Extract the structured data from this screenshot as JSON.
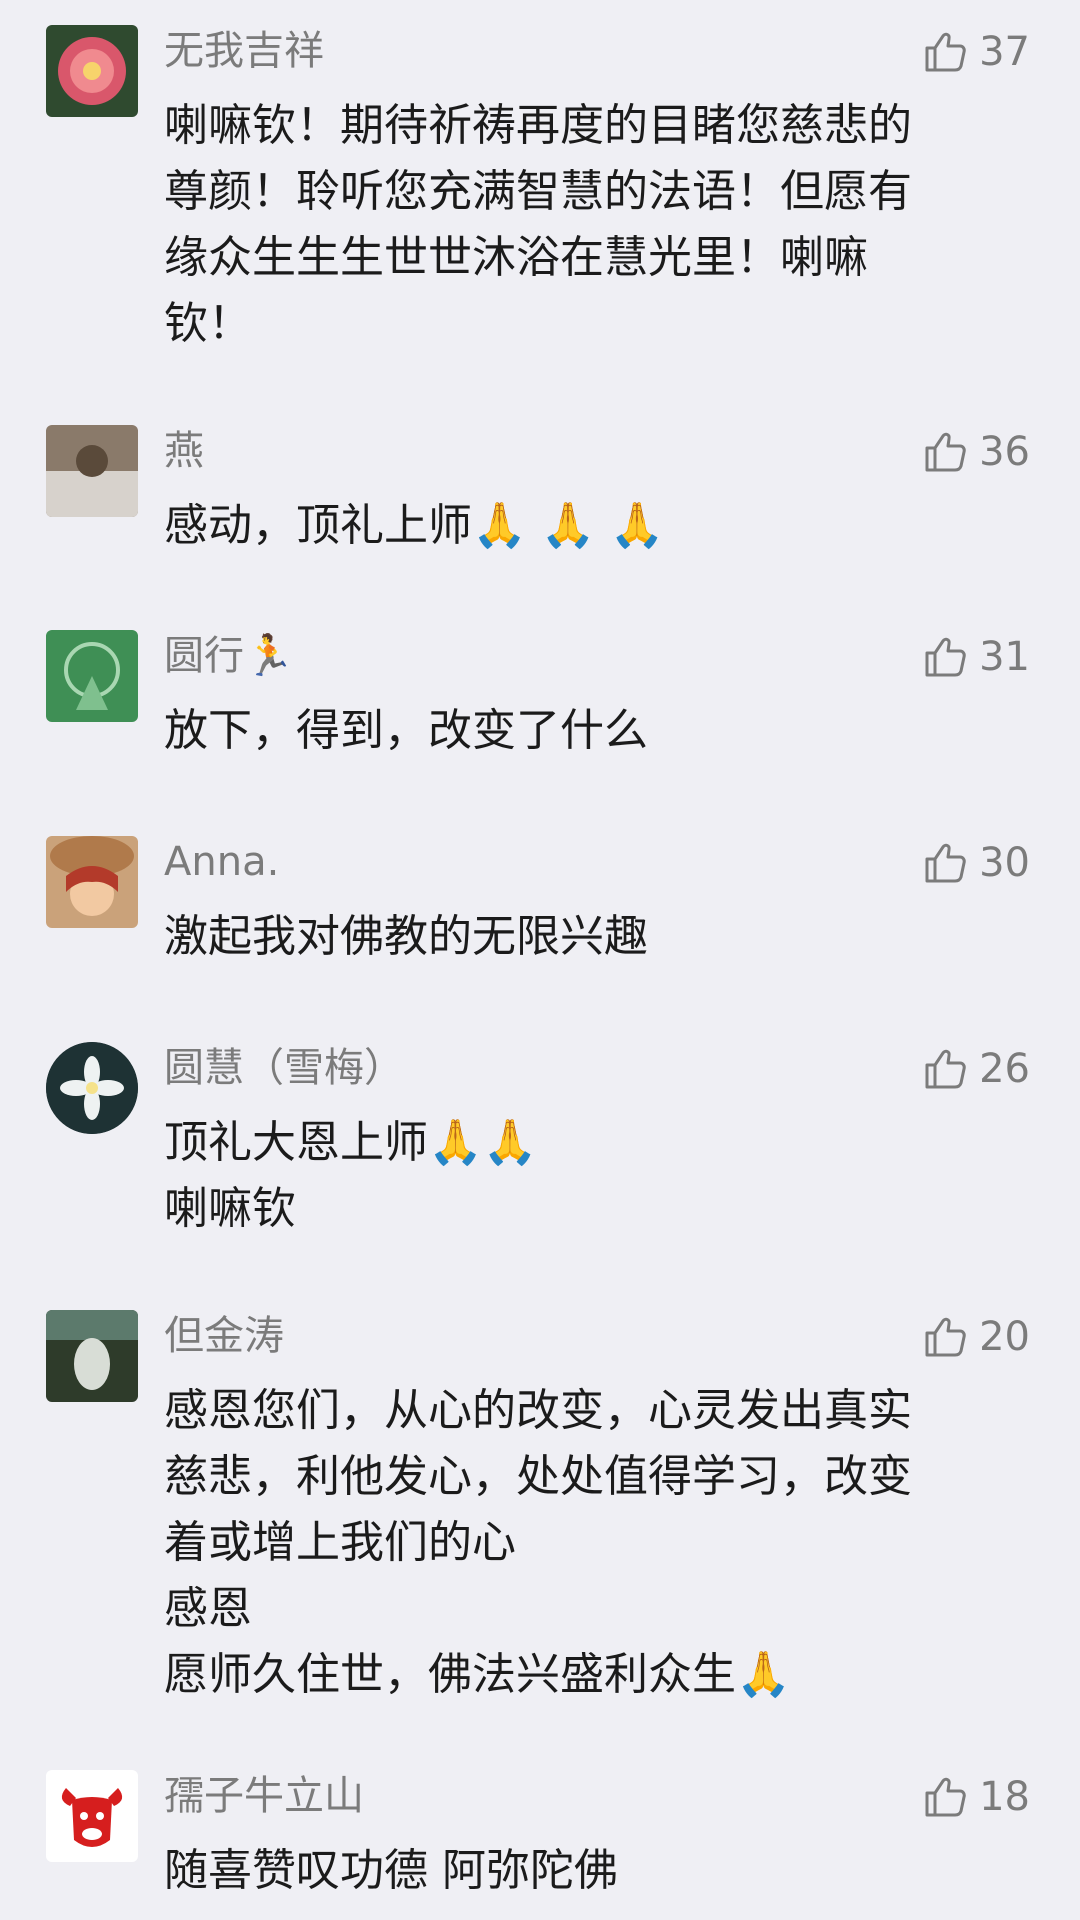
{
  "comments": [
    {
      "name": "无我吉祥",
      "likes": "37",
      "lines": [
        "喇嘛钦！期待祈祷再度的目睹您慈悲的",
        "尊颜！聆听您充满智慧的法语！但愿有",
        "缘众生生生世世沐浴在慧光里！喇嘛",
        "钦！"
      ]
    },
    {
      "name": "燕",
      "likes": "36",
      "lines": [
        "感动，顶礼上师🙏 🙏 🙏"
      ]
    },
    {
      "name": "圆行🏃",
      "likes": "31",
      "lines": [
        "放下，得到，改变了什么"
      ]
    },
    {
      "name": "Anna.",
      "likes": "30",
      "lines": [
        "激起我对佛教的无限兴趣"
      ]
    },
    {
      "name": "圆慧（雪梅）",
      "likes": "26",
      "lines": [
        "顶礼大恩上师🙏🙏",
        "喇嘛钦"
      ]
    },
    {
      "name": "但金涛",
      "likes": "20",
      "lines": [
        "感恩您们，从心的改变，心灵发出真实",
        "慈悲，利他发心，处处值得学习，改变",
        "着或增上我们的心",
        "感恩",
        "愿师久住世，佛法兴盛利众生🙏"
      ]
    },
    {
      "name": "孺子牛立山",
      "likes": "18",
      "lines": [
        "随喜赞叹功德 阿弥陀佛"
      ]
    }
  ],
  "colors": {
    "background": "#efeff4",
    "name": "#7b7b7b",
    "text": "#1b1b1b"
  },
  "icons": {
    "like": "thumbs-up-outline-icon"
  }
}
